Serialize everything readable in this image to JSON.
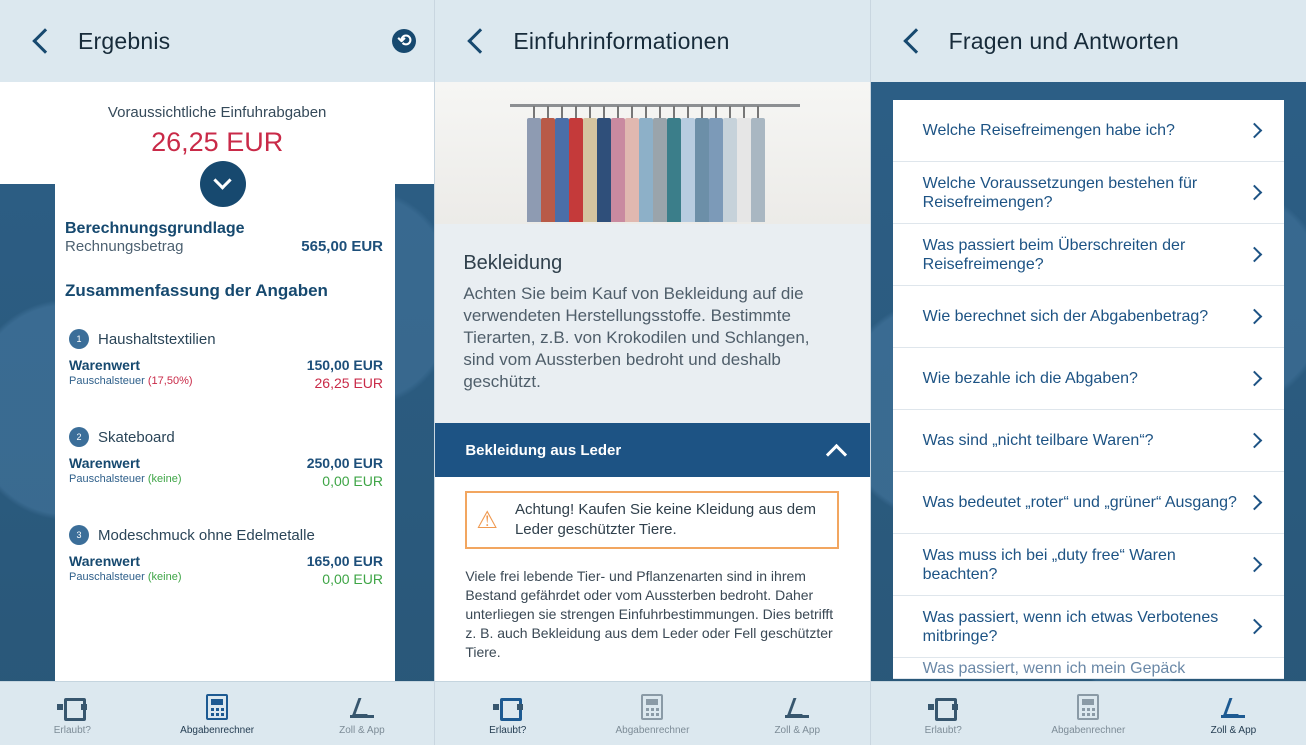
{
  "screens": {
    "result": {
      "title": "Ergebnis",
      "estimate_label": "Voraussichtliche Einfuhrabgaben",
      "estimate_value": "26,25 EUR",
      "basis_heading": "Berechnungsgrundlage",
      "invoice_label": "Rechnungsbetrag",
      "invoice_value": "565,00 EUR",
      "summary_heading": "Zusammenfassung der Angaben",
      "items": [
        {
          "num": "1",
          "name": "Haushaltstextilien",
          "value_label": "Warenwert",
          "value": "150,00 EUR",
          "tax_label": "Pauschalsteuer",
          "rate": "(17,50%)",
          "tax": "26,25 EUR"
        },
        {
          "num": "2",
          "name": "Skateboard",
          "value_label": "Warenwert",
          "value": "250,00 EUR",
          "tax_label": "Pauschalsteuer",
          "rate": "(keine)",
          "tax": "0,00 EUR"
        },
        {
          "num": "3",
          "name": "Modeschmuck ohne Edelmetalle",
          "value_label": "Warenwert",
          "value": "165,00 EUR",
          "tax_label": "Pauschalsteuer",
          "rate": "(keine)",
          "tax": "0,00 EUR"
        }
      ]
    },
    "import": {
      "title": "Einfuhrinformationen",
      "heading": "Bekleidung",
      "paragraph": "Achten Sie beim Kauf von Bekleidung auf die verwendeten Herstellungsstoffe. Bestimmte Tierarten, z.B. von Krokodilen und Schlangen, sind vom Aussterben bedroht und deshalb geschützt.",
      "accordion_label": "Bekleidung aus Leder",
      "warning": "Achtung! Kaufen Sie keine Kleidung aus dem Leder geschützter Tiere.",
      "body": "Viele frei lebende Tier- und Pflanzenarten sind in ihrem Bestand gefährdet oder vom Aussterben bedroht. Daher unterliegen sie strengen Einfuhrbestimmungen. Dies betrifft z. B. auch Bekleidung aus dem Leder oder Fell geschützter Tiere."
    },
    "faq": {
      "title": "Fragen und Antworten",
      "questions": [
        "Welche Reisefreimengen habe ich?",
        "Welche Voraussetzungen bestehen für Reisefreimengen?",
        "Was passiert beim Überschreiten der Reisefreimenge?",
        "Wie berechnet sich der Abgabenbetrag?",
        "Wie bezahle ich die Abgaben?",
        "Was sind „nicht teilbare Waren“?",
        "Was bedeutet „roter“ und „grüner“ Ausgang?",
        "Was muss ich bei „duty free“ Waren beachten?",
        "Was passiert, wenn ich etwas Verbotenes mitbringe?",
        "Was passiert, wenn ich mein Gepäck"
      ]
    }
  },
  "tabs": [
    "Erlaubt?",
    "Abgabenrechner",
    "Zoll & App"
  ],
  "colors": {
    "accent": "#1d5384",
    "danger": "#c92a48",
    "success": "#3ea546",
    "warning": "#f2a660"
  }
}
